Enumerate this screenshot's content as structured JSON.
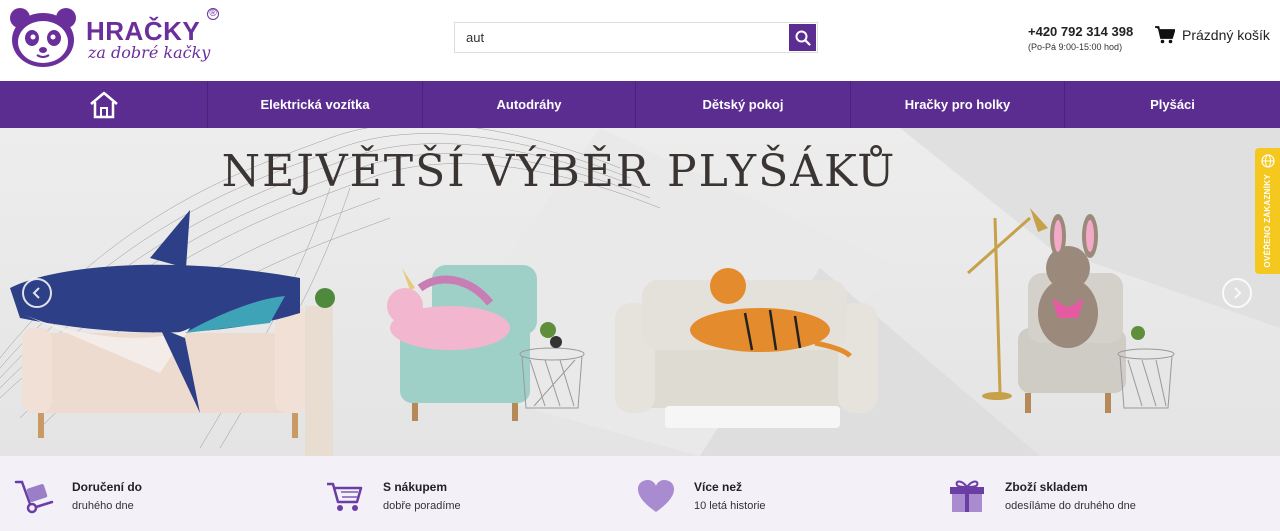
{
  "brand": {
    "title": "HRAČKY",
    "subtitle": "za dobré kačky",
    "reg": "®",
    "colors": {
      "primary": "#5b2d91",
      "accent": "#6b2f9b",
      "badge": "#f4c81e"
    }
  },
  "search": {
    "value": "aut",
    "icon": "search-icon"
  },
  "contact": {
    "phone": "+420 792 314 398",
    "hours": "(Po-Pá 9:00-15:00 hod)"
  },
  "cart": {
    "label": "Prázdný košík",
    "icon": "cart-icon"
  },
  "nav": {
    "home_icon": "home-icon",
    "items": [
      {
        "label": "Elektrická vozítka"
      },
      {
        "label": "Autodráhy"
      },
      {
        "label": "Dětský pokoj"
      },
      {
        "label": "Hračky pro holky"
      },
      {
        "label": "Plyšáci"
      }
    ]
  },
  "banner": {
    "title": "NEJVĚTŠÍ VÝBĚR PLYŠÁKŮ",
    "prev_icon": "arrow-left-icon",
    "next_icon": "arrow-right-icon"
  },
  "badge": {
    "label": "OVĚŘENO ZÁKAZNÍKY"
  },
  "features": [
    {
      "icon": "delivery-icon",
      "title": "Doručení do",
      "sub": "druhého dne"
    },
    {
      "icon": "cart-icon",
      "title": "S nákupem",
      "sub": "dobře poradíme"
    },
    {
      "icon": "heart-icon",
      "title": "Více než",
      "sub": "10 letá historie"
    },
    {
      "icon": "gift-icon",
      "title": "Zboží skladem",
      "sub": "odesíláme do druhého dne"
    }
  ]
}
